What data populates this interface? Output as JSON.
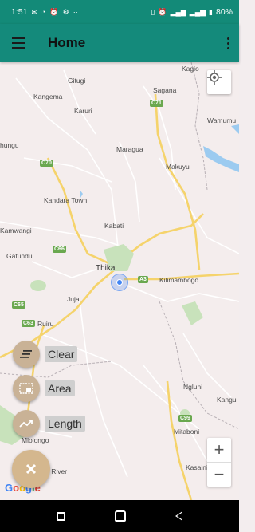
{
  "status_bar": {
    "time": "1:51",
    "battery": "80%"
  },
  "app_bar": {
    "title": "Home"
  },
  "map": {
    "places": [
      {
        "name": "Kagio"
      },
      {
        "name": "Gitugi"
      },
      {
        "name": "Sagana"
      },
      {
        "name": "Kangema"
      },
      {
        "name": "Karuri"
      },
      {
        "name": "Wamumu"
      },
      {
        "name": "hungu"
      },
      {
        "name": "Maragua"
      },
      {
        "name": "Makuyu"
      },
      {
        "name": "Kandara Town"
      },
      {
        "name": "Kabati"
      },
      {
        "name": "Kamwangi"
      },
      {
        "name": "Gatundu"
      },
      {
        "name": "Thika"
      },
      {
        "name": "Kilimambogo"
      },
      {
        "name": "Juja"
      },
      {
        "name": "Ruiru"
      },
      {
        "name": "Ngluni"
      },
      {
        "name": "Kangu"
      },
      {
        "name": "Mitaboni"
      },
      {
        "name": "Mlolongo"
      },
      {
        "name": "Kasaini"
      },
      {
        "name": "i River"
      }
    ],
    "road_shields": [
      {
        "label": "C71"
      },
      {
        "label": "C70"
      },
      {
        "label": "C66"
      },
      {
        "label": "A3"
      },
      {
        "label": "C65"
      },
      {
        "label": "C63"
      },
      {
        "label": "C99"
      }
    ]
  },
  "tools": {
    "clear_label": "Clear",
    "area_label": "Area",
    "length_label": "Length"
  },
  "attribution": {
    "google": [
      "G",
      "o",
      "o",
      "g",
      "l",
      "e"
    ]
  },
  "zoom": {
    "in": "+",
    "out": "−"
  }
}
